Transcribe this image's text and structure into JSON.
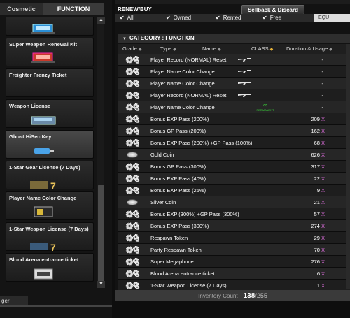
{
  "left": {
    "tabs": [
      "Cosmetic",
      "FUNCTION"
    ],
    "items": [
      {
        "label": "",
        "thumb": "laptop-blue"
      },
      {
        "label": "Super Weapon Renewal Kit",
        "thumb": "laptop-red"
      },
      {
        "label": "Freighter Frenzy Ticket",
        "thumb": "none"
      },
      {
        "label": "Weapon License",
        "thumb": "license-case"
      },
      {
        "label": "Ghost HiSec Key",
        "thumb": "usb-key"
      },
      {
        "label": "1-Star Gear License (7 Days)",
        "thumb": "gear-license"
      },
      {
        "label": "Player Name Color Change",
        "thumb": "name-color"
      },
      {
        "label": "1-Star Weapon License (7 Days)",
        "thumb": "weapon-license"
      },
      {
        "label": "Blood Arena entrance ticket",
        "thumb": "ticket"
      }
    ],
    "bottom_tab": "ger",
    "scroll_up": "▲",
    "scroll_down": "▼"
  },
  "right": {
    "renew_label": "RENEW/BUY",
    "sellback_label": "Sellback & Discard",
    "filters": [
      "All",
      "Owned",
      "Rented",
      "Free"
    ],
    "equip_label": "EQU",
    "category_label": "CATEGORY : FUNCTION",
    "columns": {
      "grade": "Grade",
      "type": "Type",
      "name": "Name",
      "class": "CLASS",
      "duration": "Duration & Usage"
    },
    "rows": [
      {
        "icon": "gear",
        "name": "Player Record (NORMAL) Reset",
        "cls": "rifle",
        "dur": "-",
        "x": ""
      },
      {
        "icon": "gear",
        "name": "Player Name Color Change",
        "cls": "rifle",
        "dur": "-",
        "x": ""
      },
      {
        "icon": "gear",
        "name": "Player Name Color Change",
        "cls": "rifle",
        "dur": "-",
        "x": ""
      },
      {
        "icon": "gear",
        "name": "Player Record (NORMAL) Reset",
        "cls": "rifle",
        "dur": "-",
        "x": ""
      },
      {
        "icon": "gear",
        "name": "Player Name Color Change",
        "cls": "permanent",
        "perm": "PERMANENT",
        "dur": "-",
        "x": ""
      },
      {
        "icon": "gear",
        "name": "Bonus EXP Pass (200%)",
        "dur": "209",
        "x": "X"
      },
      {
        "icon": "gear",
        "name": "Bonus GP Pass (200%)",
        "dur": "162",
        "x": "X"
      },
      {
        "icon": "gear",
        "name": "Bonus EXP Pass (200%) +GP Pass (100%)",
        "dur": "68",
        "x": "X"
      },
      {
        "icon": "coin",
        "name": "Gold Coin",
        "dur": "626",
        "x": "X"
      },
      {
        "icon": "gear",
        "name": "Bonus GP Pass (300%)",
        "dur": "317",
        "x": "X"
      },
      {
        "icon": "gear",
        "name": "Bonus EXP Pass (40%)",
        "dur": "22",
        "x": "X"
      },
      {
        "icon": "gear",
        "name": "Bonus EXP Pass (25%)",
        "dur": "9",
        "x": "X"
      },
      {
        "icon": "coin",
        "name": "Silver Coin",
        "dur": "21",
        "x": "X"
      },
      {
        "icon": "gear",
        "name": "Bonus EXP (300%) +GP Pass (300%)",
        "dur": "57",
        "x": "X"
      },
      {
        "icon": "gear",
        "name": "Bonus EXP Pass (300%)",
        "dur": "274",
        "x": "X"
      },
      {
        "icon": "gear",
        "name": "Respawn Token",
        "dur": "29",
        "x": "X"
      },
      {
        "icon": "gear",
        "name": "Party Respawn Token",
        "dur": "70",
        "x": "X"
      },
      {
        "icon": "gear",
        "name": "Super Megaphone",
        "dur": "276",
        "x": "X"
      },
      {
        "icon": "gear",
        "name": "Blood Arena entrance ticket",
        "dur": "6",
        "x": "X"
      },
      {
        "icon": "gear",
        "name": "1-Star Weapon License (7 Days)",
        "dur": "1",
        "x": "X"
      }
    ],
    "inventory_label": "Inventory Count",
    "inventory_count": "138",
    "inventory_total": "/255"
  },
  "colors": {
    "xmark": "#d36ad3",
    "permanent": "#3adf3a",
    "sort_gold": "#e6b33a"
  }
}
